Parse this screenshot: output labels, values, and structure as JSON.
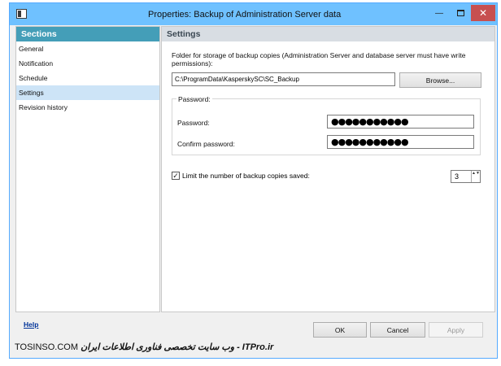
{
  "window": {
    "title": "Properties: Backup of Administration Server data"
  },
  "titlebar_buttons": {
    "minimize": "—",
    "close": "✕"
  },
  "sidebar": {
    "header": "Sections",
    "items": [
      {
        "label": "General"
      },
      {
        "label": "Notification"
      },
      {
        "label": "Schedule"
      },
      {
        "label": "Settings",
        "active": true
      },
      {
        "label": "Revision history"
      }
    ]
  },
  "panel": {
    "header": "Settings",
    "folder_label": "Folder for storage of backup copies (Administration Server and database server must have write permissions):",
    "folder_value": "C:\\ProgramData\\KasperskySC\\SC_Backup",
    "browse_label": "Browse...",
    "password_group": {
      "title": "Password:",
      "password_label": "Password:",
      "password_value": "●●●●●●●●●●●",
      "confirm_label": "Confirm password:",
      "confirm_value": "●●●●●●●●●●●"
    },
    "limit": {
      "checked": true,
      "check_mark": "✓",
      "label": "Limit the number of backup copies saved:",
      "value": "3",
      "arrows": "▲▼"
    }
  },
  "footer": {
    "help": "Help",
    "ok": "OK",
    "cancel": "Cancel",
    "apply": "Apply"
  },
  "watermark": {
    "left": "TOSINSO.COM",
    "right": "وب سایت تخصصی فناوری اطلاعات ایران - ITPro.ir"
  }
}
